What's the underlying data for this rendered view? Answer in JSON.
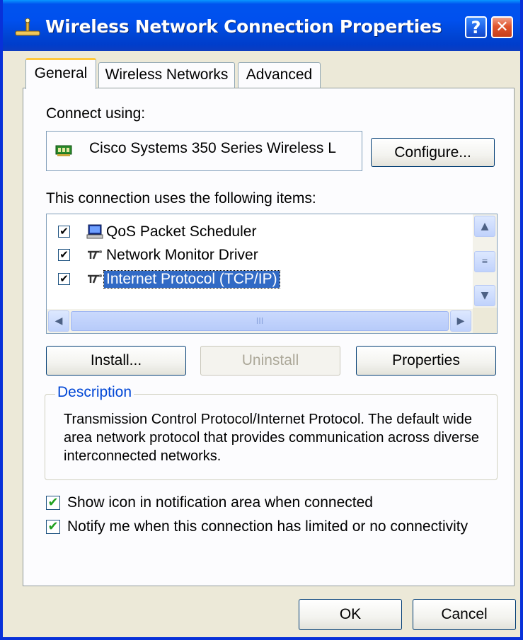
{
  "window": {
    "title": "Wireless Network Connection Properties",
    "icon": "network-connection-icon"
  },
  "titlebar_buttons": {
    "help": "?",
    "close": "✕"
  },
  "tabs": [
    {
      "label": "General",
      "active": true
    },
    {
      "label": "Wireless Networks",
      "active": false
    },
    {
      "label": "Advanced",
      "active": false
    }
  ],
  "general": {
    "connect_using_label": "Connect using:",
    "adapter_name": "Cisco Systems 350 Series Wireless L",
    "adapter_icon": "network-card-icon",
    "configure_button": "Configure...",
    "items_label": "This connection uses the following items:",
    "items": [
      {
        "label": "QoS Packet Scheduler",
        "checked": true,
        "check": "✔",
        "icon": "computer-icon",
        "selected": false
      },
      {
        "label": "Network Monitor Driver",
        "checked": true,
        "check": "✔",
        "icon": "protocol-icon",
        "selected": false
      },
      {
        "label": "Internet Protocol (TCP/IP)",
        "checked": true,
        "check": "✔",
        "icon": "protocol-icon",
        "selected": true
      }
    ],
    "scroll_thumb_grip": "III",
    "install_button": "Install...",
    "uninstall_button": "Uninstall",
    "properties_button": "Properties",
    "description_title": "Description",
    "description_text": "Transmission Control Protocol/Internet Protocol. The default wide area network protocol that provides communication across diverse interconnected networks.",
    "show_icon_option": {
      "label": "Show icon in notification area when connected",
      "checked": true,
      "check": "✔"
    },
    "notify_option": {
      "label": "Notify me when this connection has limited or no connectivity",
      "checked": true,
      "check": "✔"
    }
  },
  "footer": {
    "ok_button": "OK",
    "cancel_button": "Cancel"
  },
  "colors": {
    "titlebar": "#0050ee",
    "selection": "#316ac5",
    "group_title": "#0046d5",
    "tab_highlight": "#ffc83c"
  }
}
